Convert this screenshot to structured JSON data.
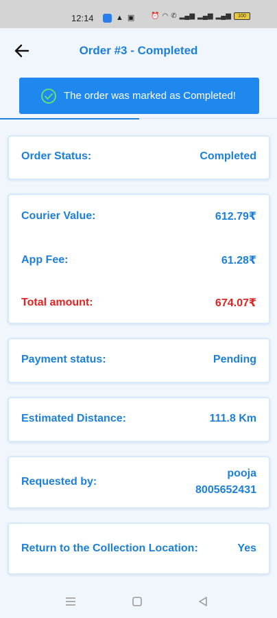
{
  "status_bar": {
    "time": "12:14",
    "battery": "100"
  },
  "header": {
    "title": "Order #3 - Completed"
  },
  "toast": {
    "message": "The order was marked as Completed!"
  },
  "order_status": {
    "label": "Order Status:",
    "value": "Completed"
  },
  "amounts": {
    "courier_label": "Courier Value:",
    "courier_value": "612.79₹",
    "fee_label": "App Fee:",
    "fee_value": "61.28₹",
    "total_label": "Total amount:",
    "total_value": "674.07₹"
  },
  "payment": {
    "label": "Payment status:",
    "value": "Pending"
  },
  "distance": {
    "label": "Estimated Distance:",
    "value": "111.8 Km"
  },
  "requester": {
    "label": "Requested by:",
    "name": "pooja",
    "phone": "8005652431"
  },
  "return_location": {
    "label": "Return to the Collection Location:",
    "value": "Yes"
  },
  "colors": {
    "primary": "#1c7fd8",
    "toast_bg": "#1e88ef",
    "total_red": "#e02424",
    "background": "#f1f6fc"
  },
  "icons": {
    "back": "arrow-left-icon",
    "toast": "check-circle-icon",
    "nav_menu": "menu-icon",
    "nav_home": "square-icon",
    "nav_back": "triangle-back-icon"
  }
}
